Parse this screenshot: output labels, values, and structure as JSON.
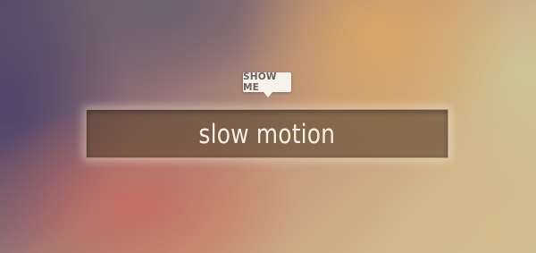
{
  "tooltip": {
    "label": "SHOW ME"
  },
  "main": {
    "text": "slow motion"
  },
  "colors": {
    "tooltip_background": "#f6f2ec",
    "tooltip_text": "#6b5e54",
    "text_color": "#f7efe3"
  }
}
